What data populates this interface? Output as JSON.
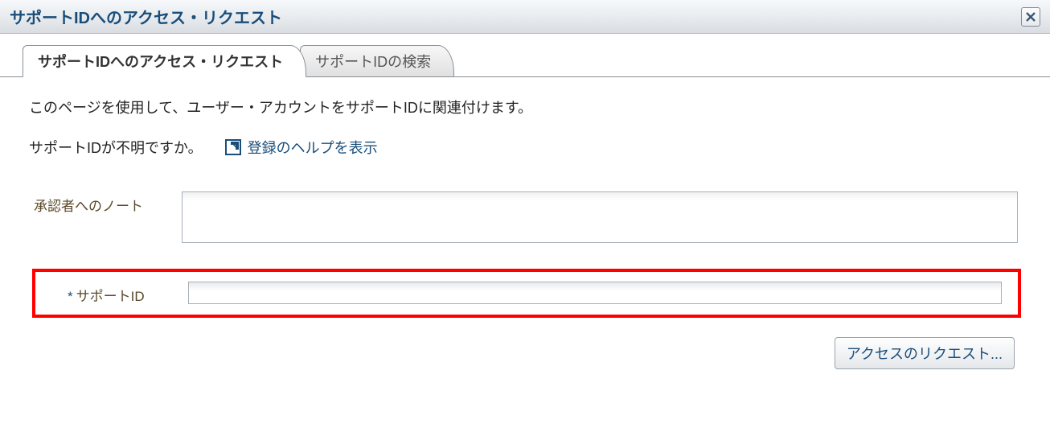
{
  "header": {
    "title": "サポートIDへのアクセス・リクエスト"
  },
  "tabs": [
    {
      "label": "サポートIDへのアクセス・リクエスト",
      "active": true
    },
    {
      "label": "サポートIDの検索",
      "active": false
    }
  ],
  "body": {
    "intro": "このページを使用して、ユーザー・アカウントをサポートIDに関連付けます。",
    "help_question": "サポートIDが不明ですか。",
    "help_link_label": "登録のヘルプを表示",
    "note_label": "承認者へのノート",
    "note_value": "",
    "support_id_label": "サポートID",
    "support_id_required_marker": "*",
    "support_id_value": ""
  },
  "footer": {
    "request_button": "アクセスのリクエスト..."
  },
  "icons": {
    "close": "close-icon",
    "external": "external-link-icon"
  }
}
